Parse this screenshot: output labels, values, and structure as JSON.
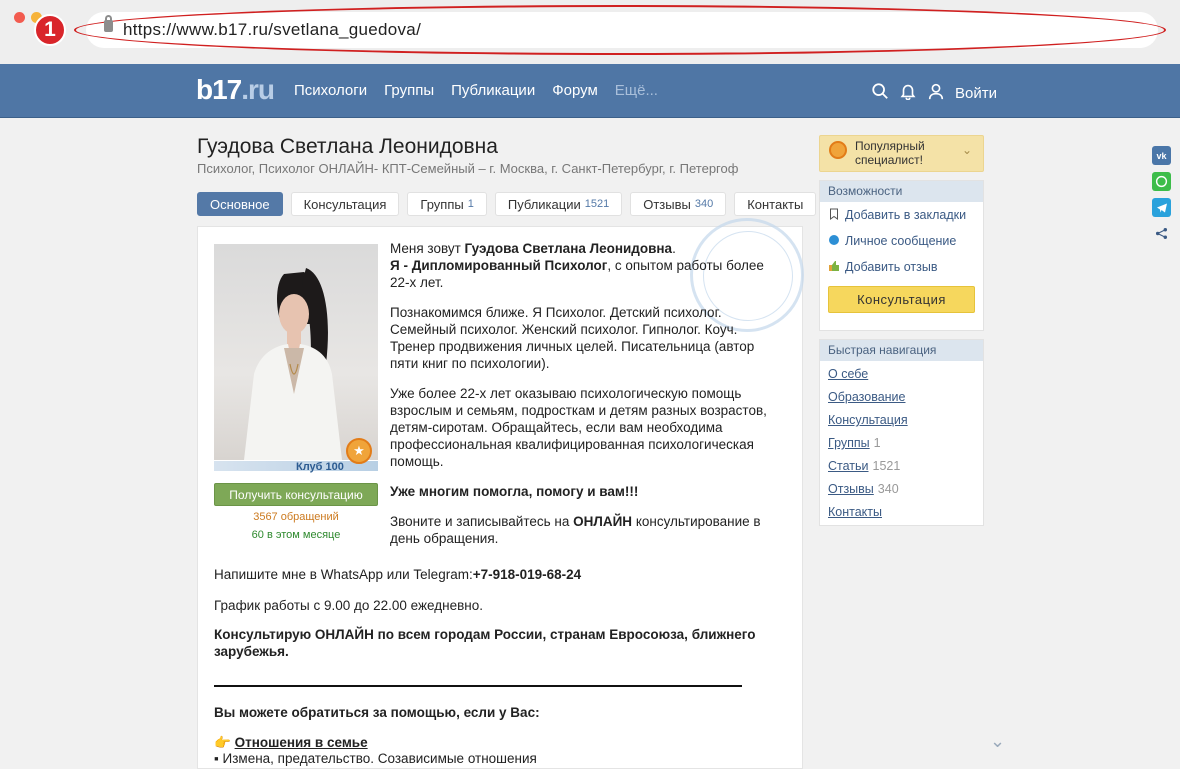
{
  "browser": {
    "url": "https://www.b17.ru/svetlana_guedova/",
    "annotation_badge": "1"
  },
  "nav": {
    "logo_main": "b17",
    "logo_suffix": ".ru",
    "links": [
      "Психологи",
      "Группы",
      "Публикации",
      "Форум"
    ],
    "more": "Ещё...",
    "login": "Войти"
  },
  "profile": {
    "name": "Гуэдова Светлана Леонидовна",
    "subtitle": "Психолог, Психолог ОНЛАЙН- КПТ-Семейный – г. Москва, г. Санкт-Петербург, г. Петергоф",
    "club": "Клуб 100",
    "get_button": "Получить консультацию",
    "requests": "3567 обращений",
    "requests_month": "60 в этом месяце"
  },
  "tabs": [
    {
      "label": "Основное",
      "count": ""
    },
    {
      "label": "Консультация",
      "count": ""
    },
    {
      "label": "Группы",
      "count": "1"
    },
    {
      "label": "Публикации",
      "count": "1521"
    },
    {
      "label": "Отзывы",
      "count": "340"
    },
    {
      "label": "Контакты",
      "count": ""
    }
  ],
  "bio": {
    "p1_a": "Меня зовут ",
    "p1_b": "Гуэдова Светлана Леонидовна",
    "p1_c": ".",
    "p1_d": "Я - Дипломированный Психолог",
    "p1_e": ", с опытом работы более 22-х лет.",
    "p2": "Познакомимся ближе. Я Психолог. Детский психолог. Семейный психолог. Женский психолог. Гипнолог. Коуч. Тренер продвижения личных целей. Писательница (автор пяти книг по психологии).",
    "p3": "Уже более 22-х лет оказываю психологическую помощь взрослым и семьям, подросткам и детям разных возрастов, детям-сиротам. Обращайтесь, если вам необходима профессиональная квалифицированная психологическая помощь.",
    "p4": "Уже многим помогла, помогу и вам!!!",
    "p5_a": "Звоните и записывайтесь на ",
    "p5_b": "ОНЛАЙН",
    "p5_c": " консультирование в день обращения.",
    "p6_a": "Напишите мне в WhatsApp или Telegram:",
    "p6_b": "+7-918-019-68-24",
    "p7": "График работы с 9.00 до 22.00 ежедневно.",
    "p8": "Консультирую ОНЛАЙН по всем городам России, странам Евросоюза, ближнего зарубежья.",
    "p9": "Вы можете обратиться за помощью, если у Вас:",
    "p10_icon": "👉",
    "p10": "Отношения в семье",
    "p11": "▪ Измена, предательство. Созависимые отношения"
  },
  "sidebar": {
    "popular": "Популярный специалист!",
    "features_title": "Возможности",
    "features": [
      "Добавить в закладки",
      "Личное сообщение",
      "Добавить отзыв"
    ],
    "consult_button": "Консультация",
    "quicknav_title": "Быстрая навигация",
    "quicknav": [
      {
        "label": "О себе",
        "count": ""
      },
      {
        "label": "Образование",
        "count": ""
      },
      {
        "label": "Консультация",
        "count": ""
      },
      {
        "label": "Группы",
        "count": "1"
      },
      {
        "label": "Статьи",
        "count": "1521"
      },
      {
        "label": "Отзывы",
        "count": "340"
      },
      {
        "label": "Контакты",
        "count": ""
      }
    ]
  },
  "social": [
    {
      "icon": "vk-icon",
      "color": "#4a76a8",
      "label": "vk"
    },
    {
      "icon": "whatsapp-icon",
      "color": "#3dbd4a",
      "label": ""
    },
    {
      "icon": "telegram-icon",
      "color": "#2aa2dc",
      "label": ""
    },
    {
      "icon": "share-icon",
      "color": "#ffffff",
      "label": ""
    }
  ]
}
